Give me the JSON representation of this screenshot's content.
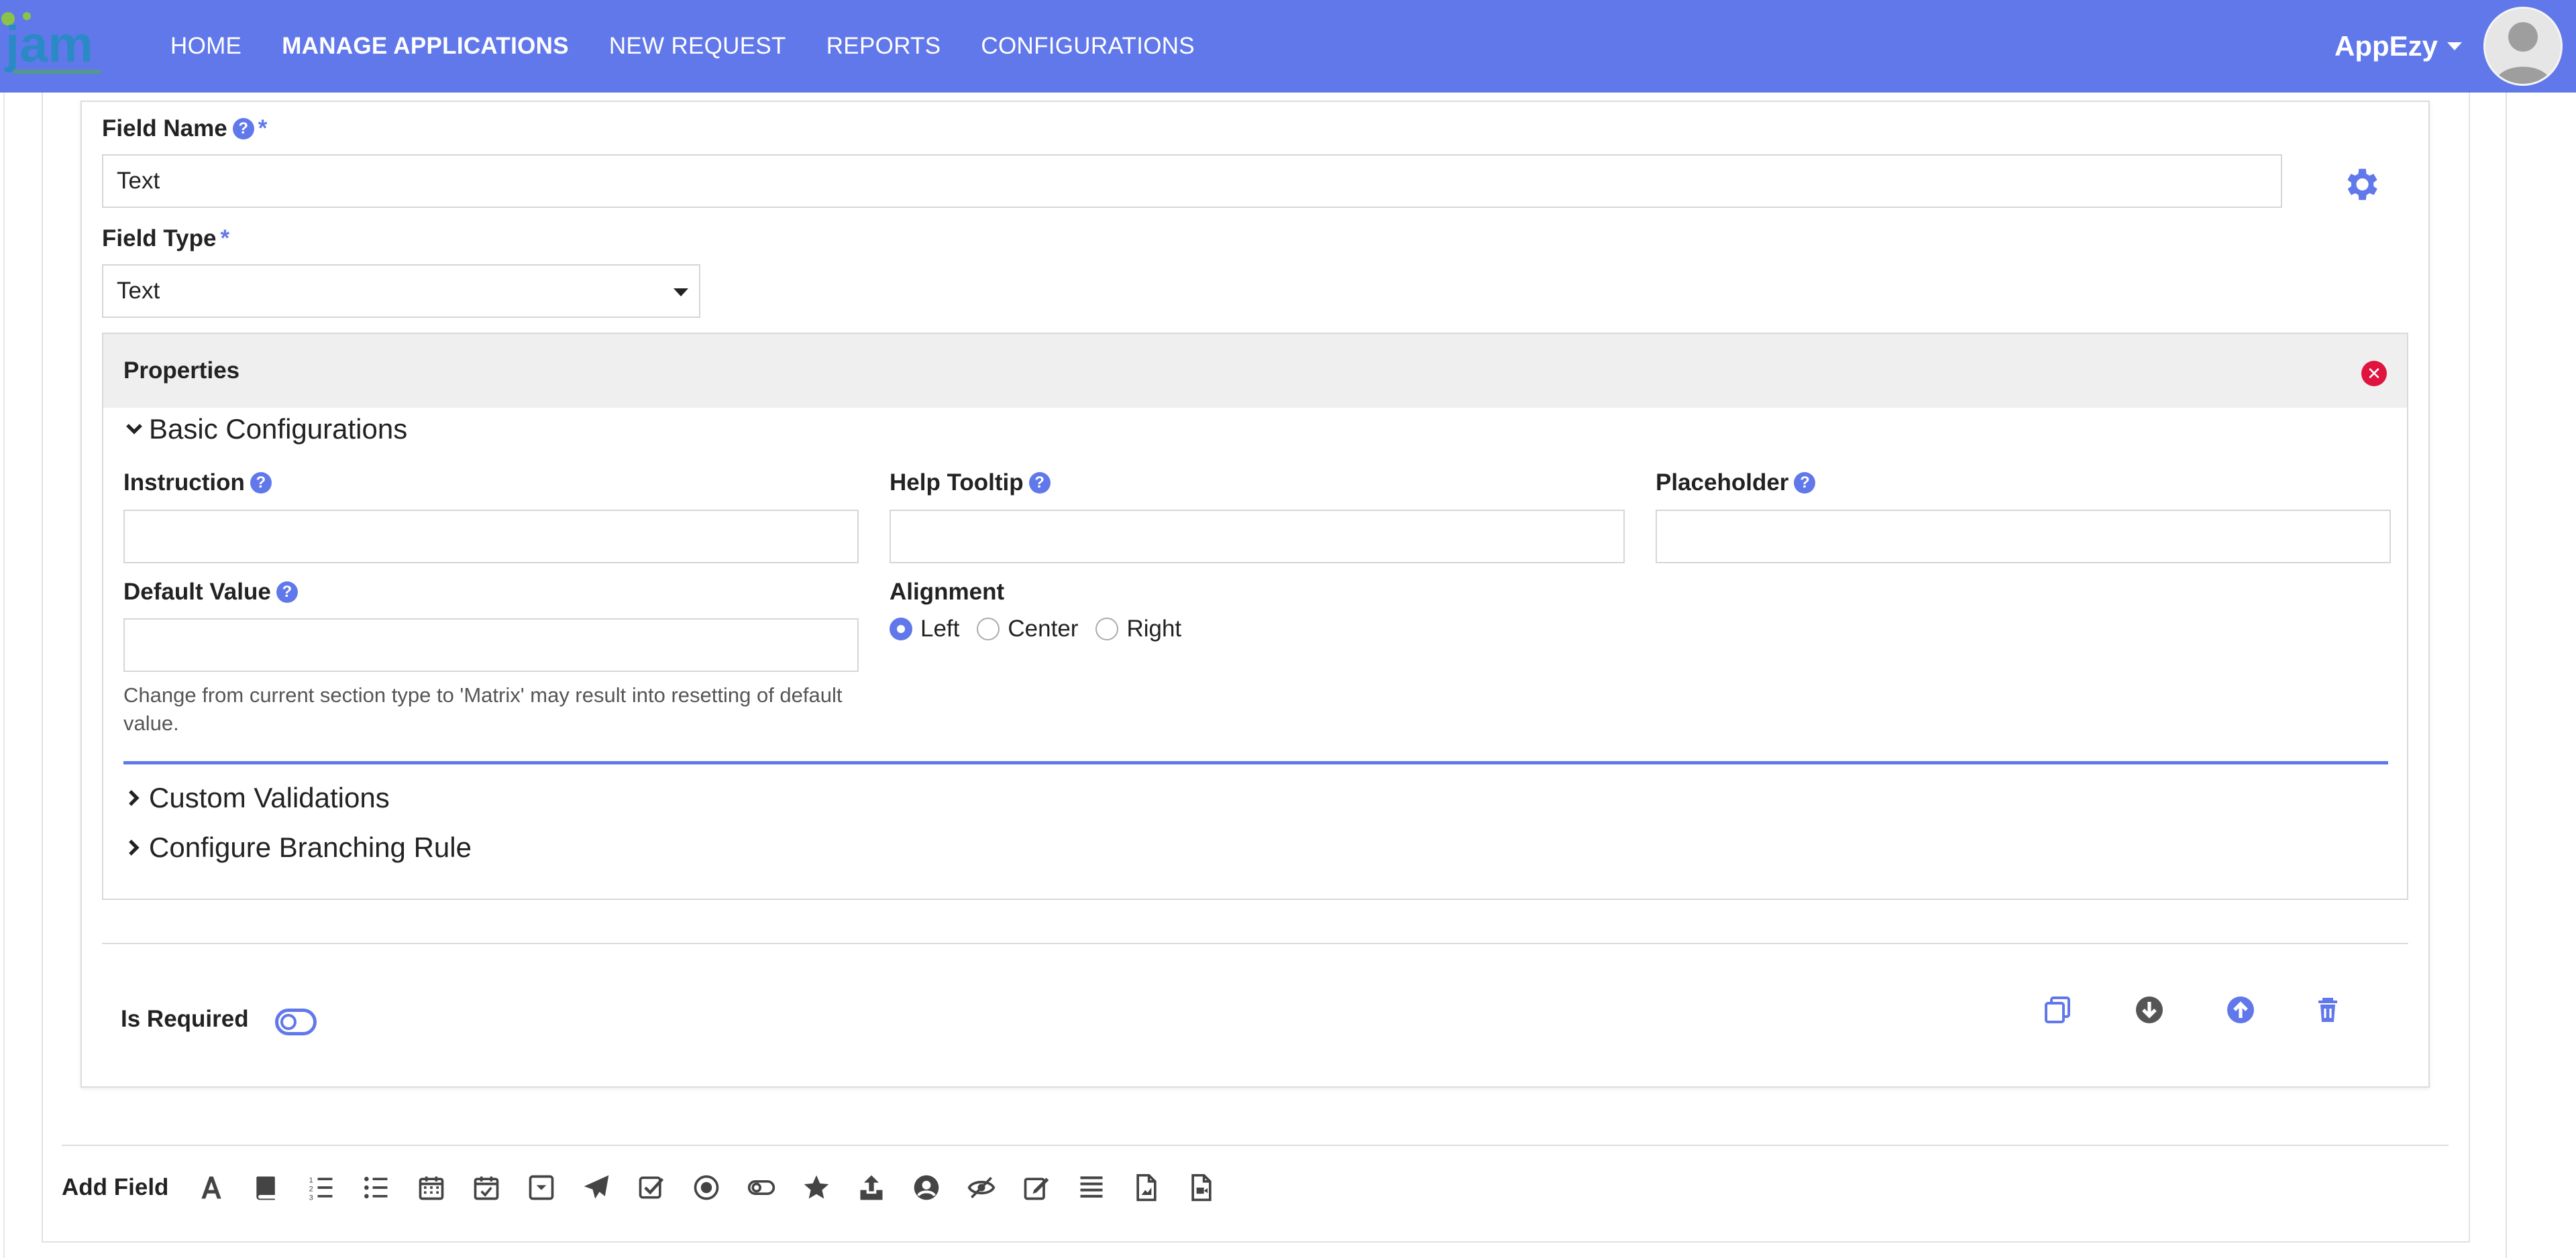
{
  "nav": {
    "items": [
      {
        "label": "HOME",
        "active": false
      },
      {
        "label": "MANAGE APPLICATIONS",
        "active": true
      },
      {
        "label": "NEW REQUEST",
        "active": false
      },
      {
        "label": "REPORTS",
        "active": false
      },
      {
        "label": "CONFIGURATIONS",
        "active": false
      }
    ],
    "user": "AppEzy",
    "logo_text": "jam"
  },
  "field": {
    "name_label": "Field Name",
    "name_value": "Text",
    "type_label": "Field Type",
    "type_value": "Text",
    "required_mark": "*"
  },
  "properties": {
    "title": "Properties",
    "basic_title": "Basic Configurations",
    "instruction_label": "Instruction",
    "help_tooltip_label": "Help Tooltip",
    "placeholder_label": "Placeholder",
    "default_value_label": "Default Value",
    "alignment_label": "Alignment",
    "alignment_options": [
      "Left",
      "Center",
      "Right"
    ],
    "alignment_selected": "Left",
    "default_hint": "Change from current section type to 'Matrix' may result into resetting of default value.",
    "custom_validations": "Custom Validations",
    "branching_rule": "Configure Branching Rule"
  },
  "footer": {
    "is_required_label": "Is Required",
    "add_field_label": "Add Field"
  },
  "colors": {
    "primary": "#6178eb",
    "danger": "#e0153f",
    "nav_bg": "#6178eb"
  },
  "toolbar_icons": [
    "text-icon",
    "book-icon",
    "ordered-list-icon",
    "unordered-list-icon",
    "calendar-icon",
    "calendar-check-icon",
    "dropdown-icon",
    "paper-plane-icon",
    "checkbox-icon",
    "radio-icon",
    "toggle-icon",
    "star-icon",
    "upload-icon",
    "user-circle-icon",
    "eye-slash-icon",
    "edit-icon",
    "paragraph-icon",
    "file-image-icon",
    "file-video-icon"
  ]
}
